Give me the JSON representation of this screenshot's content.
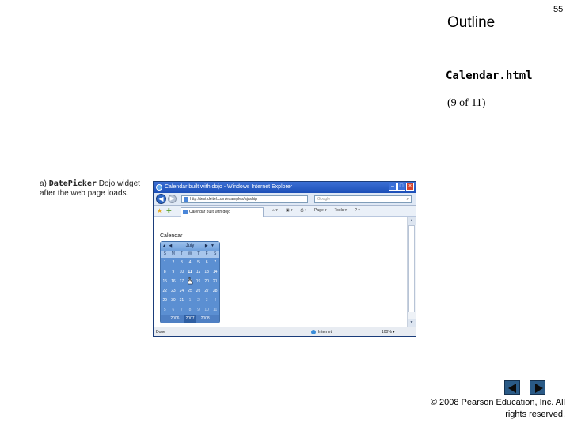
{
  "slide": {
    "outline": "Outline",
    "page_number": "55",
    "file_name": "Calendar.html",
    "part": "(9 of 11)",
    "caption_prefix": "a)",
    "caption_code": "DatePicker",
    "caption_rest": "Dojo widget after the web page loads.",
    "copyright": "© 2008 Pearson Education, Inc.  All rights reserved."
  },
  "browser": {
    "title": "Calendar built with dojo - Windows Internet Explorer",
    "url": "http://test.deitel.com/examples/ajaxhtp",
    "search_placeholder": "Google",
    "tab_label": "Calendar built with dojo",
    "commands": [
      "Page ▾",
      "Tools ▾",
      "? ▾"
    ],
    "status_done": "Done",
    "status_zone": "Internet",
    "status_zoom": "100% ▾"
  },
  "calendar": {
    "heading": "Calendar",
    "month": "July",
    "days_of_week": [
      "S",
      "M",
      "T",
      "W",
      "T",
      "F",
      "S"
    ],
    "weeks": [
      [
        "1",
        "2",
        "3",
        "4",
        "5",
        "6",
        "7"
      ],
      [
        "8",
        "9",
        "10",
        "11",
        "12",
        "13",
        "14"
      ],
      [
        "15",
        "16",
        "17",
        "18",
        "19",
        "20",
        "21"
      ],
      [
        "22",
        "23",
        "24",
        "25",
        "26",
        "27",
        "28"
      ],
      [
        "29",
        "30",
        "31",
        "1",
        "2",
        "3",
        "4"
      ],
      [
        "5",
        "6",
        "7",
        "8",
        "9",
        "10",
        "11"
      ]
    ],
    "years": [
      "2006",
      "2007",
      "2008"
    ],
    "current_year": "2007"
  }
}
